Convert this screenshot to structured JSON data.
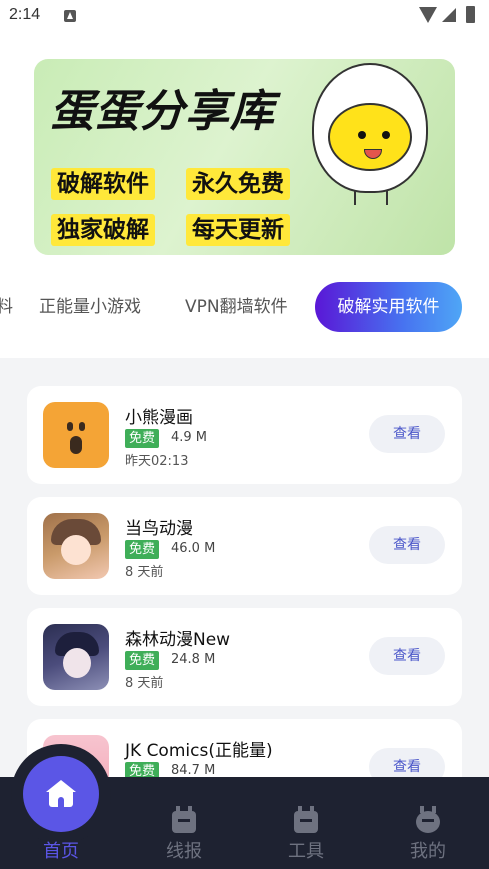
{
  "status_bar": {
    "time": "2:14"
  },
  "banner": {
    "title": "蛋蛋分享库",
    "tags": [
      "破解软件",
      "永久免费",
      "独家破解",
      "每天更新"
    ]
  },
  "tabs": [
    {
      "label": "料"
    },
    {
      "label": "正能量小游戏"
    },
    {
      "label": "VPN翻墙软件"
    },
    {
      "label": "破解实用软件",
      "active": true
    }
  ],
  "apps": [
    {
      "name": "小熊漫画",
      "badge": "免费",
      "size": "4.9 M",
      "time": "昨天02:13",
      "action": "查看",
      "icon": "bear-icon"
    },
    {
      "name": "当鸟动漫",
      "badge": "免费",
      "size": "46.0 M",
      "time": "8 天前",
      "action": "查看",
      "icon": "anime-girl-icon"
    },
    {
      "name": "森林动漫New",
      "badge": "免费",
      "size": "24.8 M",
      "time": "8 天前",
      "action": "查看",
      "icon": "anime-boy-icon"
    },
    {
      "name": "JK Comics(正能量)",
      "badge": "免费",
      "size": "84.7 M",
      "time": "",
      "action": "查看",
      "icon": "pink-icon"
    }
  ],
  "nav": {
    "items": [
      {
        "label": "首页",
        "active": true,
        "icon": "home-icon"
      },
      {
        "label": "线报",
        "icon": "box-icon"
      },
      {
        "label": "工具",
        "icon": "toolbox-icon"
      },
      {
        "label": "我的",
        "icon": "profile-icon"
      }
    ],
    "accent": "#5b56e6"
  }
}
